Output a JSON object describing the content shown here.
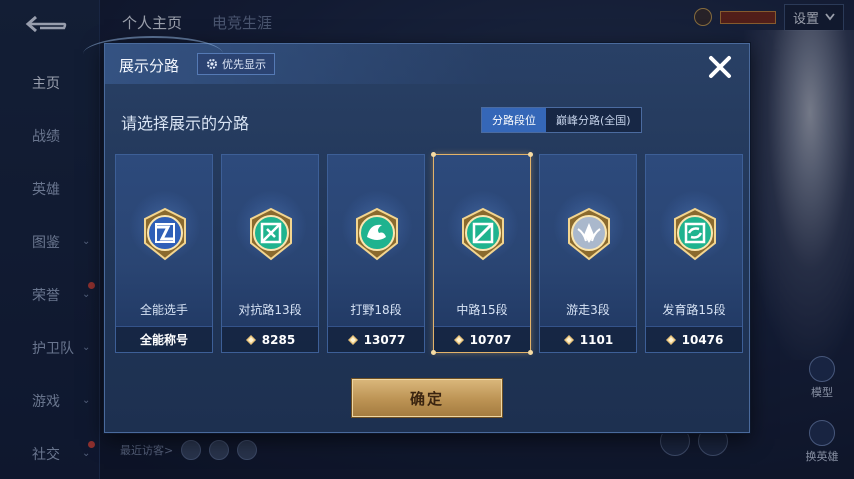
{
  "background": {
    "back_icon": "back-arrow-icon",
    "top_tabs": [
      {
        "label": "个人主页",
        "active": true
      },
      {
        "label": "电竞生涯",
        "active": false
      }
    ],
    "settings_label": "设置",
    "side_menu": [
      {
        "label": "主页",
        "active": true,
        "chevron": false,
        "dot": false
      },
      {
        "label": "战绩",
        "active": false,
        "chevron": false,
        "dot": false
      },
      {
        "label": "英雄",
        "active": false,
        "chevron": false,
        "dot": false
      },
      {
        "label": "图鉴",
        "active": false,
        "chevron": true,
        "dot": false
      },
      {
        "label": "荣誉",
        "active": false,
        "chevron": true,
        "dot": true
      },
      {
        "label": "护卫队",
        "active": false,
        "chevron": true,
        "dot": false
      },
      {
        "label": "游戏",
        "active": false,
        "chevron": true,
        "dot": false
      },
      {
        "label": "社交",
        "active": false,
        "chevron": true,
        "dot": true
      }
    ],
    "recent_visitors_label": "最近访客>",
    "right_buttons": [
      {
        "label": "模型"
      },
      {
        "label": "换英雄"
      }
    ]
  },
  "modal": {
    "title": "展示分路",
    "priority_button": "优先显示",
    "close_icon": "close-icon",
    "subtitle": "请选择展示的分路",
    "toggle": [
      {
        "label": "分路段位",
        "active": true
      },
      {
        "label": "巅峰分路(全国)",
        "active": false
      }
    ],
    "cards": [
      {
        "label": "全能选手",
        "value": "全能称号",
        "show_diamond": false,
        "selected": false,
        "badge": "all-round"
      },
      {
        "label": "对抗路13段",
        "value": "8285",
        "show_diamond": true,
        "selected": false,
        "badge": "clash-lane"
      },
      {
        "label": "打野18段",
        "value": "13077",
        "show_diamond": true,
        "selected": false,
        "badge": "jungle"
      },
      {
        "label": "中路15段",
        "value": "10707",
        "show_diamond": true,
        "selected": true,
        "badge": "mid-lane"
      },
      {
        "label": "游走3段",
        "value": "1101",
        "show_diamond": true,
        "selected": false,
        "badge": "roam"
      },
      {
        "label": "发育路15段",
        "value": "10476",
        "show_diamond": true,
        "selected": false,
        "badge": "farm-lane"
      }
    ],
    "confirm_label": "确定"
  },
  "colors": {
    "accent_blue": "#3567b8",
    "gold": "#d9b67a",
    "teal_badge": "#1fb38f",
    "blue_badge": "#2f5fb8",
    "silver_badge": "#aab8cc"
  }
}
